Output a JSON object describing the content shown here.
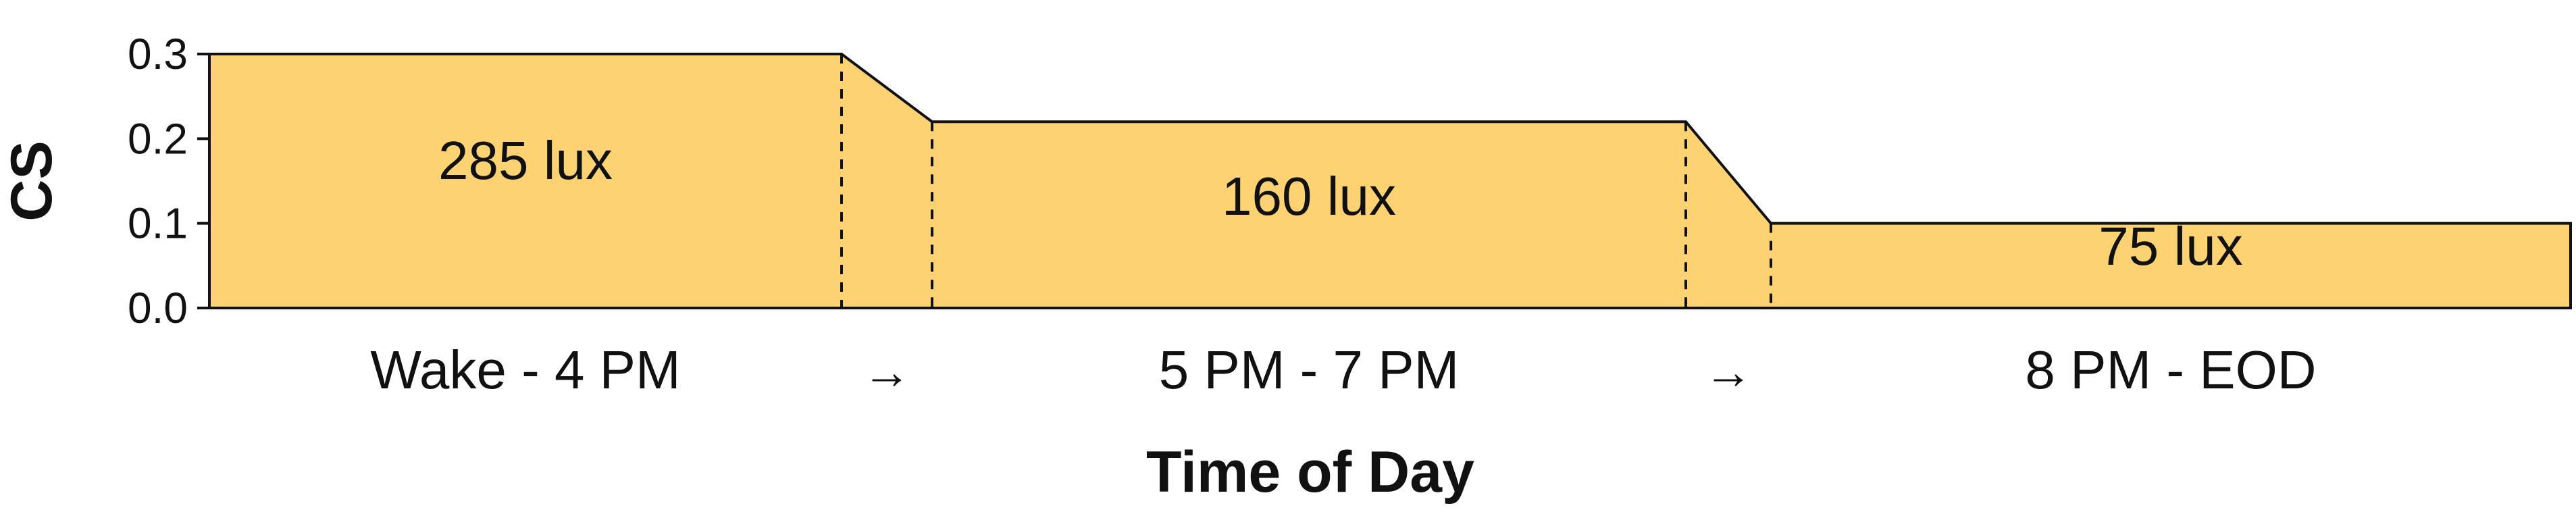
{
  "chart_data": {
    "type": "area",
    "xlabel": "Time of Day",
    "ylabel": "CS",
    "ylim": [
      0,
      0.3
    ],
    "yticks": [
      "0.0",
      "0.1",
      "0.2",
      "0.3"
    ],
    "fill_color": "#FDD272",
    "line_color": "#111111",
    "segments": [
      {
        "category": "Wake - 4 PM",
        "cs": 0.3,
        "label": "285 lux"
      },
      {
        "category": "5 PM - 7 PM",
        "cs": 0.22,
        "label": "160 lux"
      },
      {
        "category": "8 PM - EOD",
        "cs": 0.1,
        "label": "75 lux"
      }
    ],
    "transitions": [
      "→",
      "→"
    ]
  }
}
